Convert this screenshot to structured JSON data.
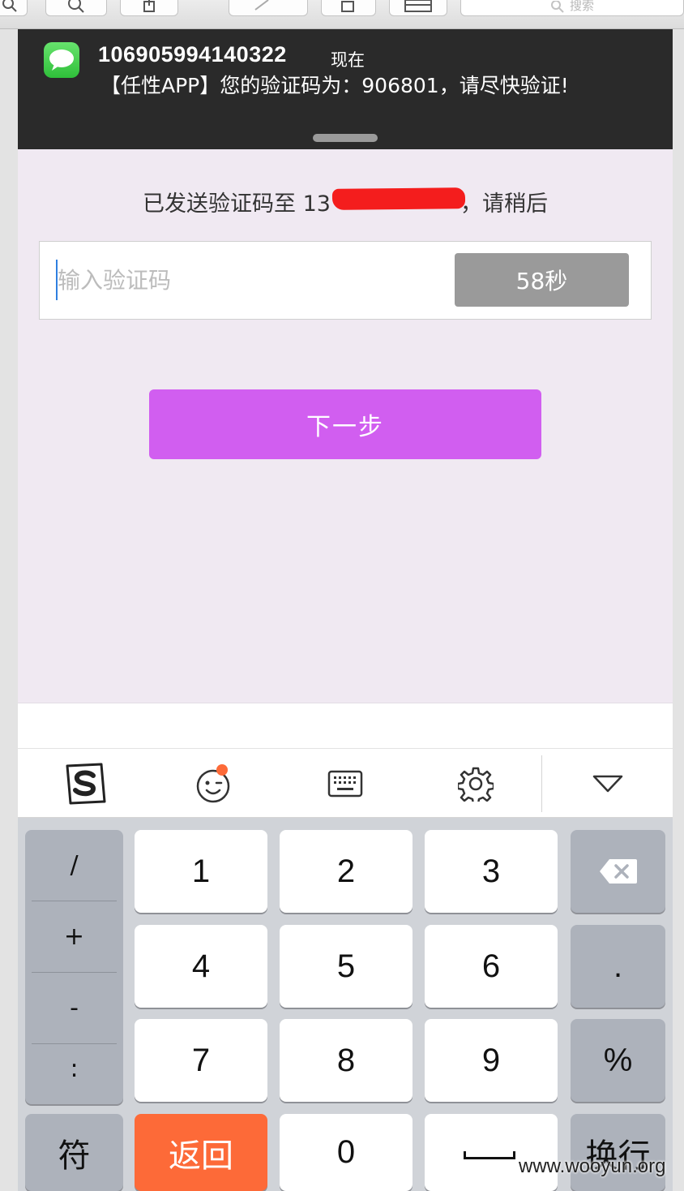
{
  "host_toolbar": {
    "search_placeholder": "搜索"
  },
  "notification": {
    "sender": "106905994140322",
    "time": "现在",
    "body": "【任性APP】您的验证码为：906801，请尽快验证!"
  },
  "verify": {
    "sent_prefix": "已发送验证码至 13",
    "sent_suffix": "，请稍后",
    "code_placeholder": "输入验证码",
    "timer_label": "58秒",
    "next_label": "下一步"
  },
  "keyboard": {
    "toolbar_icons": [
      "sogou-logo-icon",
      "emoji-icon",
      "keyboard-icon",
      "settings-gear-icon",
      "collapse-triangle-icon"
    ],
    "symbols": [
      "/",
      "+",
      "-",
      ":"
    ],
    "digits": [
      "1",
      "2",
      "3",
      "4",
      "5",
      "6",
      "7",
      "8",
      "9",
      "0"
    ],
    "dot": ".",
    "percent": "%",
    "symbol_key": "符",
    "back_key": "返回",
    "newline_key": "换行"
  },
  "colors": {
    "next_button": "#d15ef0",
    "back_key": "#fd6a38",
    "timer_button": "#9a9a9a",
    "redaction": "#f41d1d"
  },
  "watermark": "www.wooyun.org"
}
